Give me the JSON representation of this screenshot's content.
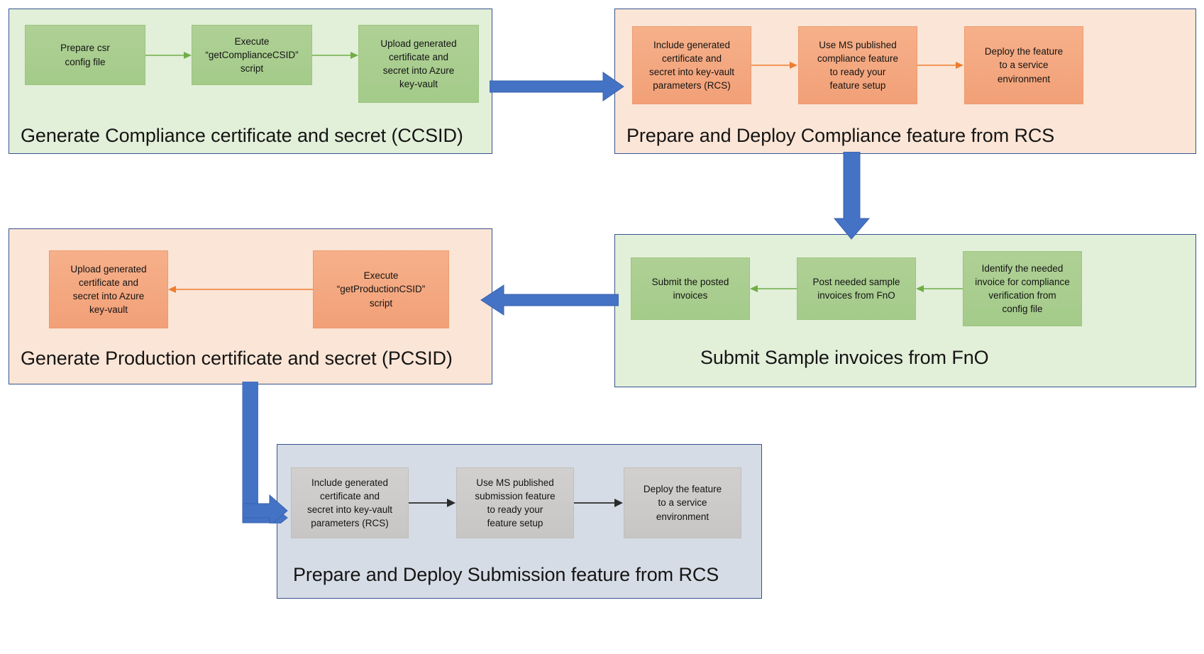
{
  "diagram": {
    "title_font_color": "#151515",
    "colors": {
      "green_group_bg": "#E2EFD9",
      "orange_group_bg": "#FBE5D6",
      "gray_group_bg": "#D6DCE5",
      "group_border": "#36548F",
      "green_node": "#A9CE8F",
      "orange_node": "#F4A77F",
      "gray_node": "#CCCAC8",
      "green_arrow": "#70AD47",
      "orange_arrow": "#ED7D31",
      "gray_arrow": "#2B2B2B",
      "blue_arrow": "#4472C4"
    },
    "groups": [
      {
        "id": "ccsid",
        "title": "Generate Compliance certificate and secret (CCSID)",
        "style": "green",
        "nodes": [
          {
            "id": "ccsid-1",
            "lines": [
              "Prepare csr",
              "config file"
            ]
          },
          {
            "id": "ccsid-2",
            "lines": [
              "Execute",
              "“getComplianceCSID”",
              "script"
            ]
          },
          {
            "id": "ccsid-3",
            "lines": [
              "Upload generated",
              "certificate and",
              "secret into Azure",
              "key-vault"
            ]
          }
        ]
      },
      {
        "id": "prepare-compliance",
        "title": "Prepare and Deploy Compliance feature from RCS",
        "style": "orange",
        "nodes": [
          {
            "id": "pc-1",
            "lines": [
              "Include generated",
              "certificate and",
              "secret into key-vault",
              "parameters (RCS)"
            ]
          },
          {
            "id": "pc-2",
            "lines": [
              "Use MS published",
              "compliance feature",
              "to ready your",
              "feature setup"
            ]
          },
          {
            "id": "pc-3",
            "lines": [
              "Deploy the feature",
              "to a service",
              "environment"
            ]
          }
        ]
      },
      {
        "id": "pcsid",
        "title": "Generate Production certificate and secret (PCSID)",
        "style": "orange",
        "nodes": [
          {
            "id": "pcsid-1",
            "lines": [
              "Upload generated",
              "certificate and",
              "secret into Azure",
              "key-vault"
            ]
          },
          {
            "id": "pcsid-2",
            "lines": [
              "Execute",
              "“getProductionCSID”",
              "script"
            ]
          }
        ]
      },
      {
        "id": "submit-invoices",
        "title": "Submit Sample invoices from FnO",
        "style": "green",
        "nodes": [
          {
            "id": "si-1",
            "lines": [
              "Submit the posted",
              "invoices"
            ]
          },
          {
            "id": "si-2",
            "lines": [
              "Post needed sample",
              "invoices from FnO"
            ]
          },
          {
            "id": "si-3",
            "lines": [
              "Identify the needed",
              "invoice for compliance",
              "verification from",
              "config file"
            ]
          }
        ]
      },
      {
        "id": "prepare-submission",
        "title": "Prepare and Deploy Submission feature from RCS",
        "style": "gray",
        "nodes": [
          {
            "id": "ps-1",
            "lines": [
              "Include generated",
              "certificate and",
              "secret into key-vault",
              "parameters (RCS)"
            ]
          },
          {
            "id": "ps-2",
            "lines": [
              "Use MS published",
              "submission feature",
              "to ready your",
              "feature setup"
            ]
          },
          {
            "id": "ps-3",
            "lines": [
              "Deploy the feature",
              "to a service",
              "environment"
            ]
          }
        ]
      }
    ]
  }
}
